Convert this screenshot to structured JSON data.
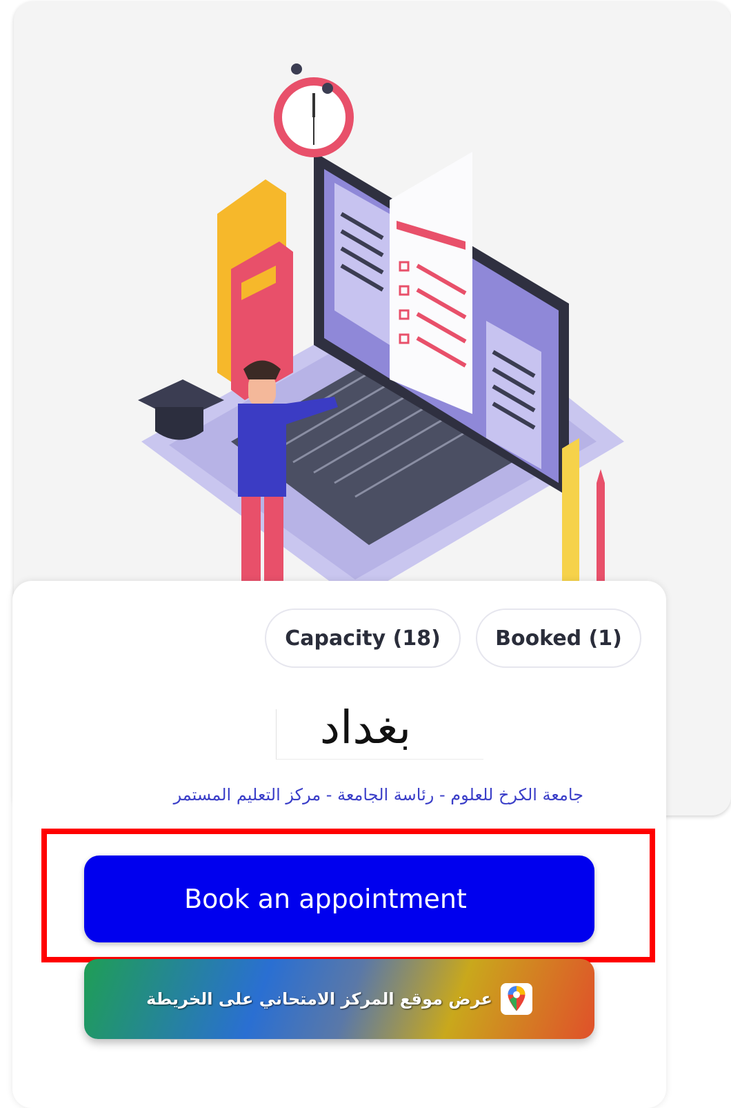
{
  "badges": {
    "capacity": "Capacity (18)",
    "booked": "Booked (1)"
  },
  "center": {
    "city": "بغداد",
    "address": "جامعة الكرخ للعلوم - رئاسة الجامعة - مركز التعليم المستمر"
  },
  "actions": {
    "book_label": "Book an appointment",
    "map_label": "عرض موقع المركز الامتحاني على الخريطة",
    "map_icon": "google-maps-pin-icon"
  },
  "colors": {
    "primary_button": "#0000ee",
    "highlight_border": "#ff0000",
    "address_text": "#3a3ec8"
  }
}
